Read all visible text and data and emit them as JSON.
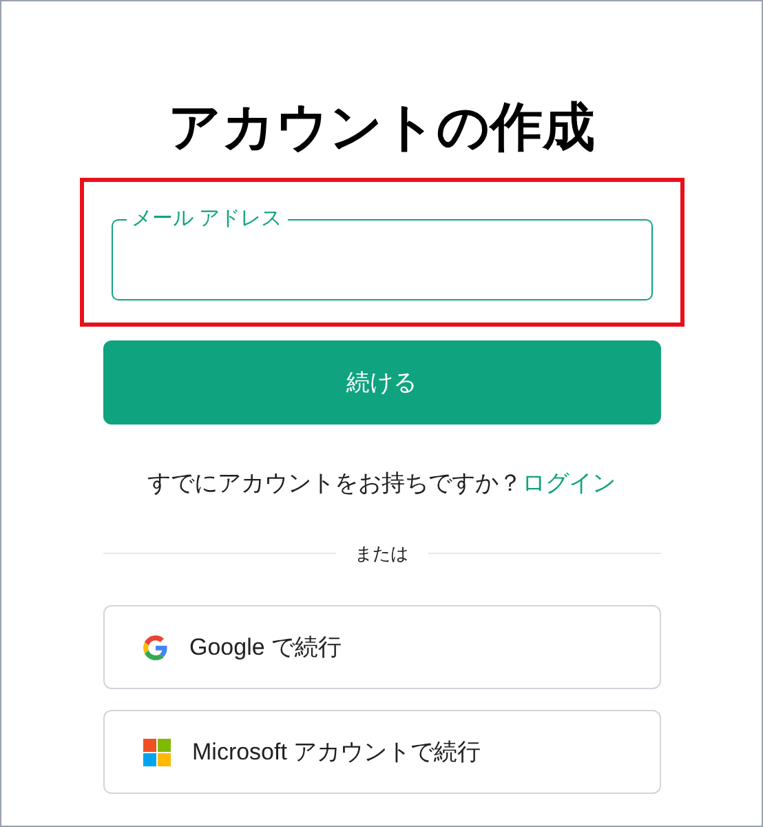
{
  "title": "アカウントの作成",
  "email_field": {
    "label": "メール アドレス",
    "highlighted": true
  },
  "continue_button": "続ける",
  "login_prompt": {
    "text": "すでにアカウントをお持ちですか？",
    "link": "ログイン"
  },
  "divider": "または",
  "social_buttons": [
    {
      "kind": "google",
      "label": "Google で続行"
    },
    {
      "kind": "microsoft",
      "label": "Microsoft アカウントで続行"
    }
  ]
}
